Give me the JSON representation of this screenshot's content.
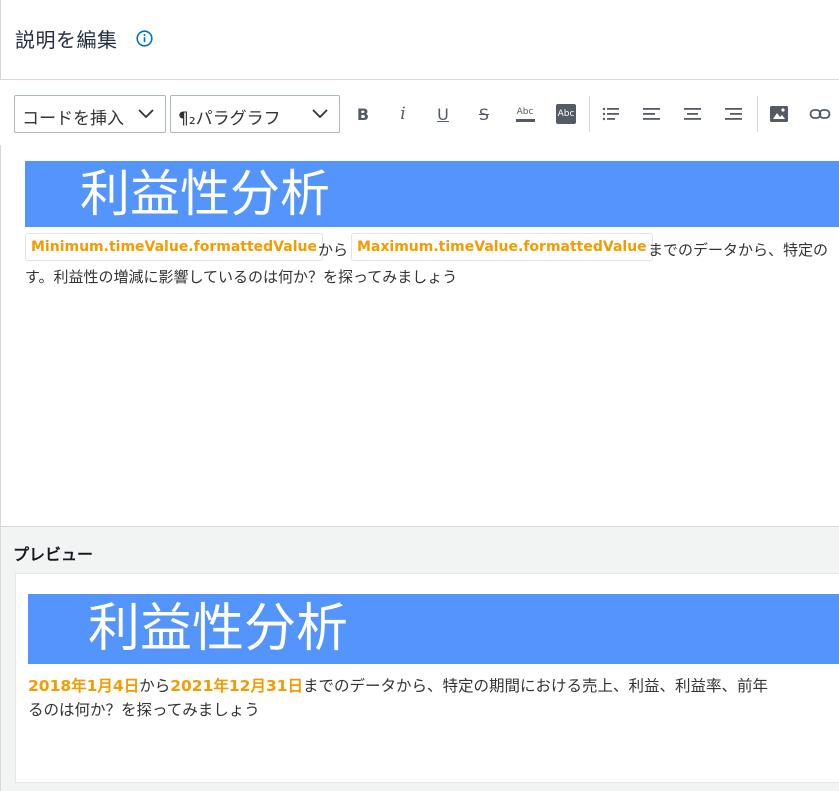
{
  "header": {
    "title": "説明を編集"
  },
  "toolbar": {
    "insert_code_label": "コードを挿入",
    "paragraph_label": "¶₂パラグラフ",
    "bold_label": "B",
    "italic_label": "i",
    "underline_label": "U",
    "strike_label": "S",
    "text_color_label": "Abc",
    "highlight_label": "Abc"
  },
  "editor": {
    "heading": "利益性分析",
    "chip_min": "Minimum.timeValue.formattedValue",
    "from_text": "から",
    "chip_max": "Maximum.timeValue.formattedValue",
    "line1_rest": "までのデータから、特定の",
    "line2": "す。利益性の増減に影響しているのは何か？を探ってみましょう"
  },
  "preview": {
    "title": "プレビュー",
    "heading": "利益性分析",
    "start_date": "2018年1月4日",
    "from_text": "から",
    "end_date": "2021年12月31日",
    "line1_rest": "までのデータから、特定の期間における売上、利益、利益率、前年",
    "line2": "るのは何か？を探ってみましょう"
  },
  "colors": {
    "banner": "#5394fd",
    "accent_orange": "#f59b00",
    "info_blue": "#0073bb"
  }
}
